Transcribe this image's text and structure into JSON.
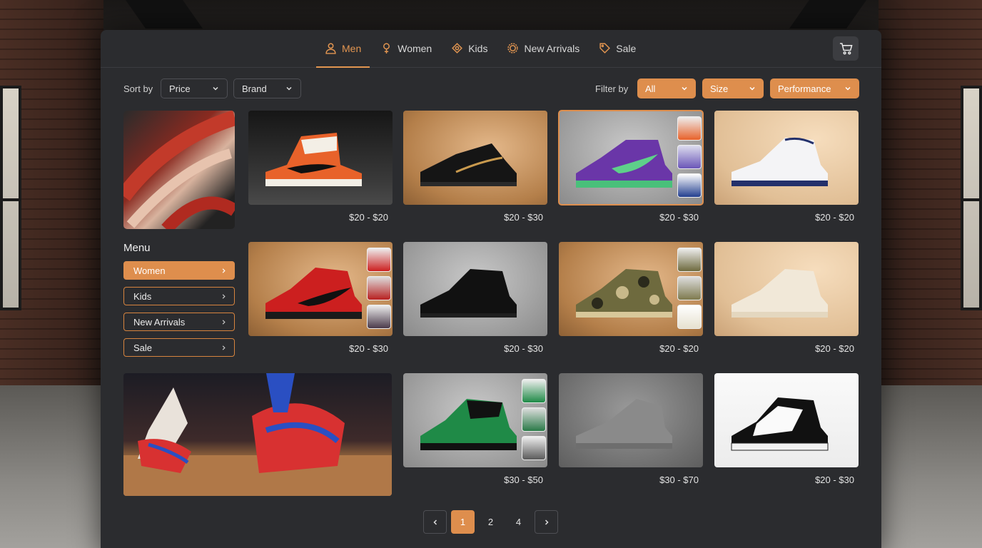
{
  "nav": {
    "tabs": [
      {
        "label": "Men",
        "icon": "person-icon"
      },
      {
        "label": "Women",
        "icon": "female-icon"
      },
      {
        "label": "Kids",
        "icon": "kids-icon"
      },
      {
        "label": "New Arrivals",
        "icon": "badge-icon"
      },
      {
        "label": "Sale",
        "icon": "tag-icon"
      }
    ],
    "active_tab": "Men",
    "cart_icon": "cart-icon"
  },
  "toolbar": {
    "sort_label": "Sort by",
    "sort_options": [
      "Price",
      "Brand"
    ],
    "filter_label": "Filter by",
    "filter_options": [
      "All",
      "Size",
      "Performance"
    ]
  },
  "sidebar": {
    "menu_title": "Menu",
    "items": [
      "Women",
      "Kids",
      "New Arrivals",
      "Sale"
    ],
    "active_item": "Women"
  },
  "products": [
    {
      "price": "$20 - $20",
      "color": "orange-white"
    },
    {
      "price": "$20 - $30",
      "color": "black-gold"
    },
    {
      "price": "$20 - $30",
      "color": "purple-green"
    },
    {
      "price": "$20 - $20",
      "color": "white-navy"
    },
    {
      "price": "$20 - $30",
      "color": "red-black"
    },
    {
      "price": "$20 - $30",
      "color": "triple-black"
    },
    {
      "price": "$20 - $20",
      "color": "camo"
    },
    {
      "price": "$20 - $20",
      "color": "cream"
    },
    {
      "price": "$30 - $50",
      "color": "green-black"
    },
    {
      "price": "$30 - $70",
      "color": "grey-knit"
    },
    {
      "price": "$20 - $30",
      "color": "black-white"
    }
  ],
  "pagination": {
    "pages": [
      "1",
      "2",
      "4"
    ],
    "current": "1"
  },
  "colors": {
    "accent": "#de8e4d",
    "panel": "#2b2c2f"
  }
}
